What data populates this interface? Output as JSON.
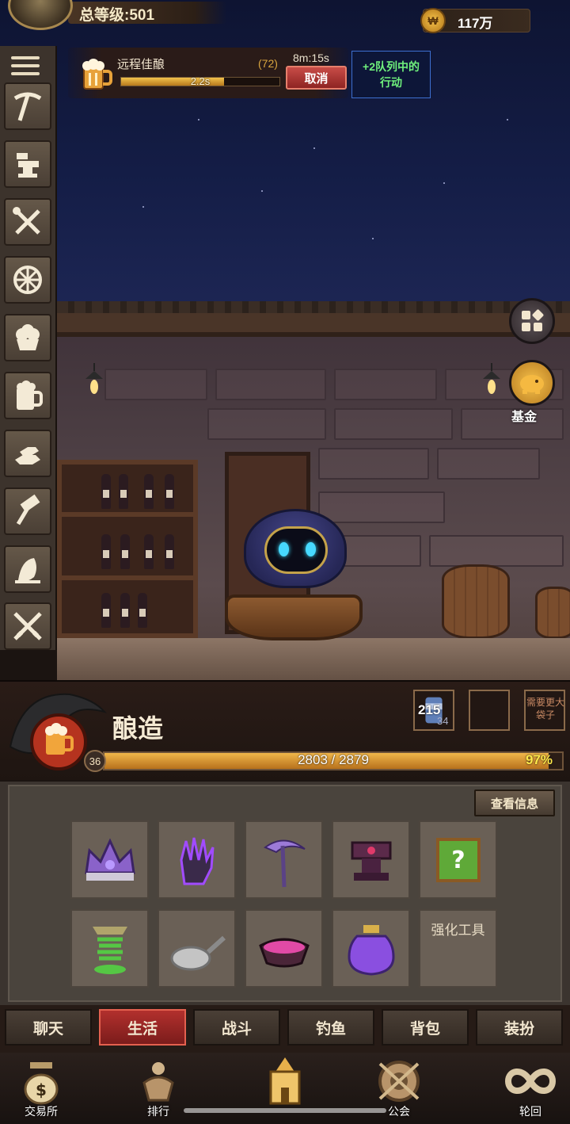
{
  "player": {
    "level_label": "总等级:501"
  },
  "currency": {
    "amount": "117万",
    "icon": "coin-icon"
  },
  "active_action": {
    "name": "远程佳酿",
    "count": "(72)",
    "progress_seconds": "2.2s",
    "progress_fraction": 0.65,
    "remaining_time": "8m:15s",
    "cancel_label": "取消",
    "queue_note": "+2队列中的行动"
  },
  "sidebar": {
    "menu_icon": "menu-icon",
    "skills": [
      {
        "icon": "pickaxe-icon"
      },
      {
        "icon": "anvil-icon"
      },
      {
        "icon": "crossed-tools-icon"
      },
      {
        "icon": "knot-icon"
      },
      {
        "icon": "cupcake-icon"
      },
      {
        "icon": "beer-mug-icon"
      },
      {
        "icon": "gold-bars-icon"
      },
      {
        "icon": "hammer-icon"
      },
      {
        "icon": "fish-icon"
      },
      {
        "icon": "crossed-swords-icon"
      }
    ]
  },
  "scene": {
    "side_buttons": [
      {
        "icon": "grid-menu-icon",
        "label": ""
      },
      {
        "icon": "piggy-bank-icon",
        "label": "基金"
      }
    ]
  },
  "skill": {
    "name": "酿造",
    "icon": "beer-mug-icon",
    "level": "36",
    "xp_text": "2803 / 2879",
    "xp_percent": "97%",
    "xp_fraction": 0.97,
    "slots": [
      {
        "main": "215",
        "sub": "34",
        "icon": "can-icon"
      },
      {
        "main": "",
        "sub": ""
      },
      {
        "note": "需要更大袋子"
      }
    ]
  },
  "panel": {
    "info_button": "查看信息",
    "items": [
      {
        "icon": "crown-icon"
      },
      {
        "icon": "gauntlet-icon"
      },
      {
        "icon": "scythe-icon"
      },
      {
        "icon": "anvil-icon"
      },
      {
        "icon": "mystery-box-icon"
      },
      {
        "icon": "spring-tool-icon"
      },
      {
        "icon": "frying-pan-icon"
      },
      {
        "icon": "bowl-icon"
      },
      {
        "icon": "potion-jar-icon"
      }
    ],
    "enhance_label": "强化工具"
  },
  "tabs": [
    "聊天",
    "生活",
    "战斗",
    "钓鱼",
    "背包",
    "装扮"
  ],
  "active_tab": 1,
  "bottom_nav": [
    {
      "label": "交易所",
      "icon": "money-bag-icon"
    },
    {
      "label": "排行",
      "icon": "trophy-icon"
    },
    {
      "label": "",
      "icon": "castle-icon"
    },
    {
      "label": "公会",
      "icon": "guild-emblem-icon"
    },
    {
      "label": "轮回",
      "icon": "infinity-icon"
    }
  ],
  "colors": {
    "accent_red": "#b2302d",
    "xp_gold": "#f0b64a",
    "queue_green": "#6ff07c",
    "queue_border": "#3d6fd0"
  }
}
